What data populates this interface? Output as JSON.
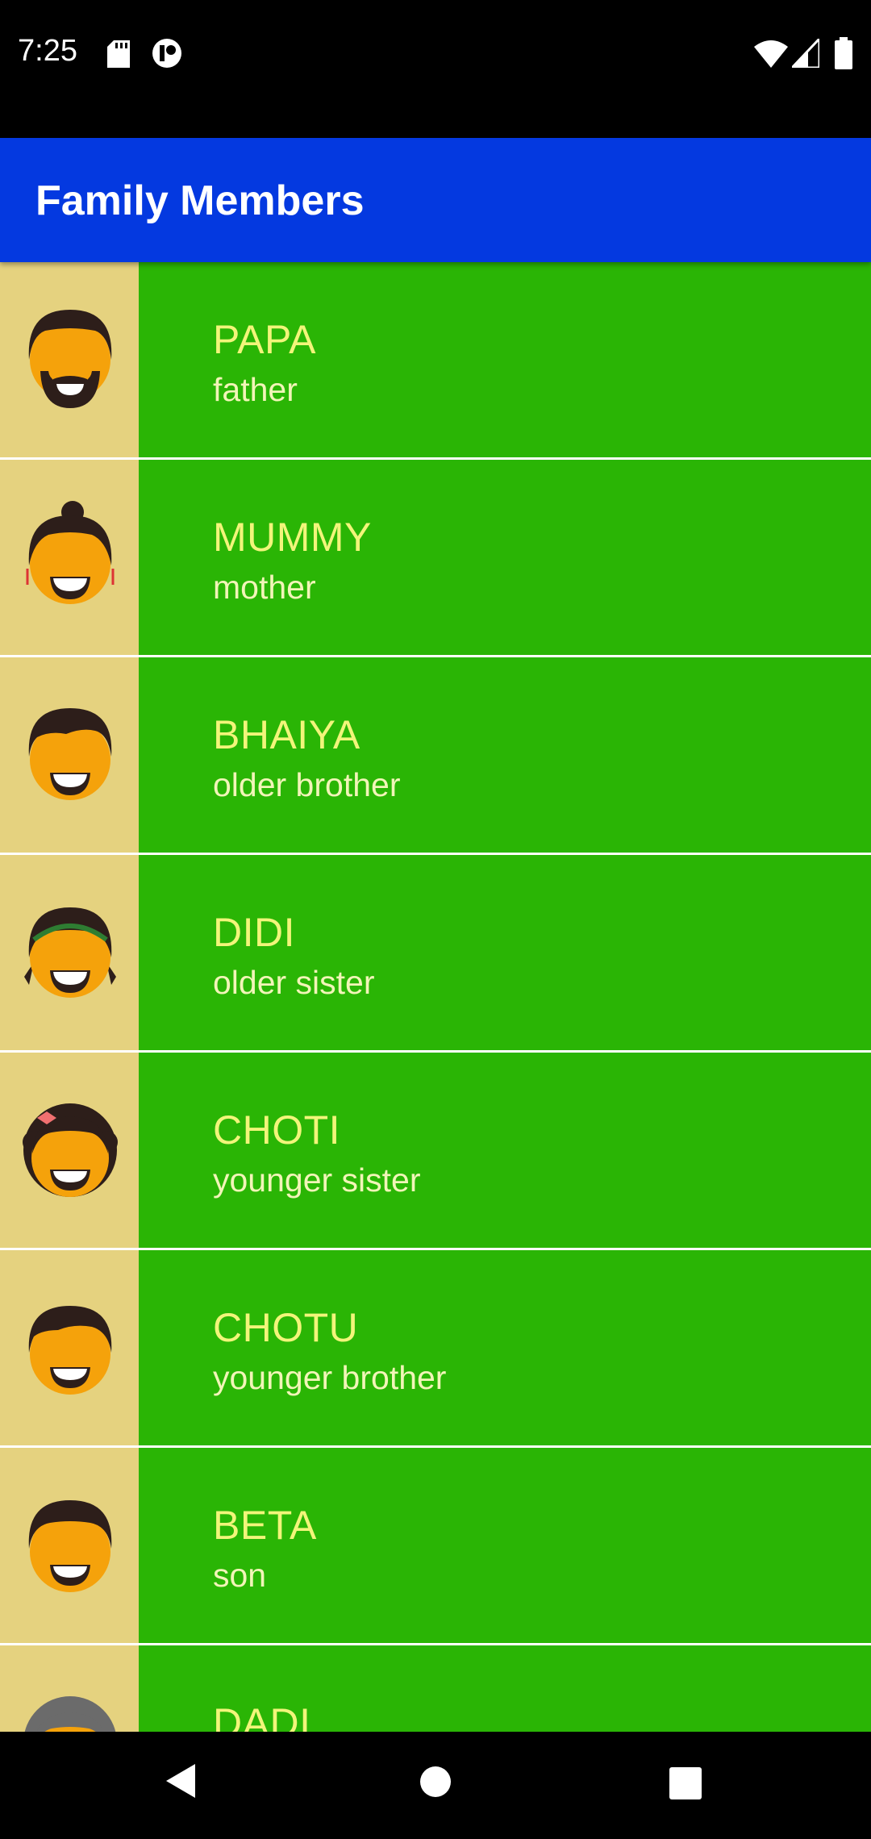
{
  "status_bar": {
    "time": "7:25",
    "left_icons": [
      "sd-card-icon",
      "notification-app-icon"
    ],
    "right_icons": [
      "wifi-icon",
      "cell-signal-icon",
      "battery-icon"
    ]
  },
  "app_bar": {
    "title": "Family Members",
    "color": "#0439e0"
  },
  "colors": {
    "row_bg": "#2ab505",
    "avatar_bg": "#e5d27f",
    "name_text": "#f2f57a"
  },
  "members": [
    {
      "name": "PAPA",
      "relation": "father",
      "icon": "father-avatar-icon"
    },
    {
      "name": "MUMMY",
      "relation": "mother",
      "icon": "mother-avatar-icon"
    },
    {
      "name": "BHAIYA",
      "relation": "older brother",
      "icon": "older-brother-avatar-icon"
    },
    {
      "name": "DIDI",
      "relation": "older sister",
      "icon": "older-sister-avatar-icon"
    },
    {
      "name": "CHOTI",
      "relation": "younger sister",
      "icon": "younger-sister-avatar-icon"
    },
    {
      "name": "CHOTU",
      "relation": "younger brother",
      "icon": "younger-brother-avatar-icon"
    },
    {
      "name": "BETA",
      "relation": "son",
      "icon": "son-avatar-icon"
    },
    {
      "name": "DADI",
      "relation": "",
      "icon": "grandmother-avatar-icon"
    }
  ],
  "nav_bar": {
    "buttons": [
      "back-icon",
      "home-icon",
      "recents-icon"
    ]
  }
}
